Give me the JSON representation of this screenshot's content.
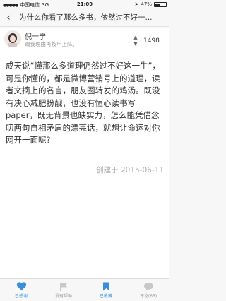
{
  "status_bar": {
    "carrier": "中国电信",
    "network": "3G",
    "time": "21:09",
    "battery": "47%",
    "battery_level": 0.47
  },
  "nav": {
    "title": "为什么你看了那么多书，依然过不好一..."
  },
  "author": {
    "name": "倪一宁",
    "bio": "踢我理由再按甲上阵。",
    "votes": "1498"
  },
  "answer": {
    "text": "成天说“懂那么多道理仍然过不好这一生”，可是你懂的，都是微博营销号上的道理，读者文摘上的名言，朋友圈转发的鸡汤。既没有决心减肥扮靓，也没有恒心读书写paper，既无背景也缺实力，怎么能凭借念叨两句自相矛盾的漂亮话，就想让命运对你网开一面呢?",
    "created": "创建于 2015-06-11"
  },
  "tabs": [
    {
      "label": "已感谢",
      "icon": "heart-icon",
      "active": true
    },
    {
      "label": "没有帮助",
      "icon": "flag-icon",
      "active": false
    },
    {
      "label": "已收藏",
      "icon": "bookmark-icon",
      "active": true
    },
    {
      "label": "评论(65)",
      "icon": "comment-icon",
      "active": false
    }
  ],
  "colors": {
    "accent": "#3b8ede",
    "inactive": "#cccccc"
  }
}
